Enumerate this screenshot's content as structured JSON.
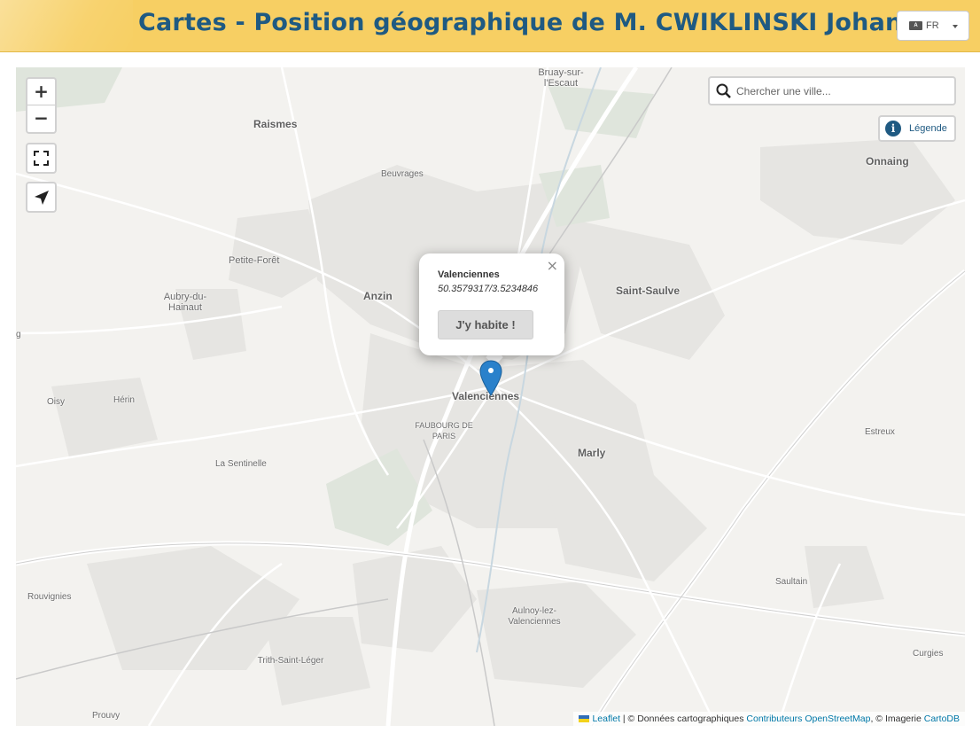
{
  "header": {
    "title": "Cartes - Position géographique de M. CWIKLINSKI Johan",
    "language_label": "FR"
  },
  "map": {
    "places": {
      "bruay": "Bruay-sur-l'Escaut",
      "raismes": "Raismes",
      "beuvrages": "Beuvrages",
      "onnaing": "Onnaing",
      "petite_foret": "Petite-Forêt",
      "anzin": "Anzin",
      "aubry": "Aubry-du-Hainaut",
      "saint_saulve": "Saint-Saulve",
      "valenciennes": "Valenciennes",
      "faubourg": "FAUBOURG DE PARIS",
      "oisy": "Oisy",
      "herin": "Hérin",
      "estreux": "Estreux",
      "marly": "Marly",
      "la_sentinelle": "La Sentinelle",
      "rouvignies": "Rouvignies",
      "saultain": "Saultain",
      "aulnoy": "Aulnoy-lez-Valenciennes",
      "trith": "Trith-Saint-Léger",
      "curgies": "Curgies",
      "prouvy": "Prouvy",
      "edge": "g"
    },
    "controls": {
      "zoom_in": "+",
      "zoom_out": "−"
    },
    "search": {
      "placeholder": "Chercher une ville..."
    },
    "legend_label": "Légende",
    "popup": {
      "close": "×",
      "city": "Valenciennes",
      "coords": "50.3579317/3.5234846",
      "button": "J'y habite !"
    },
    "attribution": {
      "leaflet": "Leaflet",
      "sep1": " | © Données cartographiques ",
      "osm": "Contributeurs OpenStreetMap",
      "sep2": ", © Imagerie ",
      "carto": "CartoDB"
    },
    "colors": {
      "marker": "#2a81cb",
      "title": "#1f5a82",
      "header_bg": "#f7cf63"
    }
  }
}
